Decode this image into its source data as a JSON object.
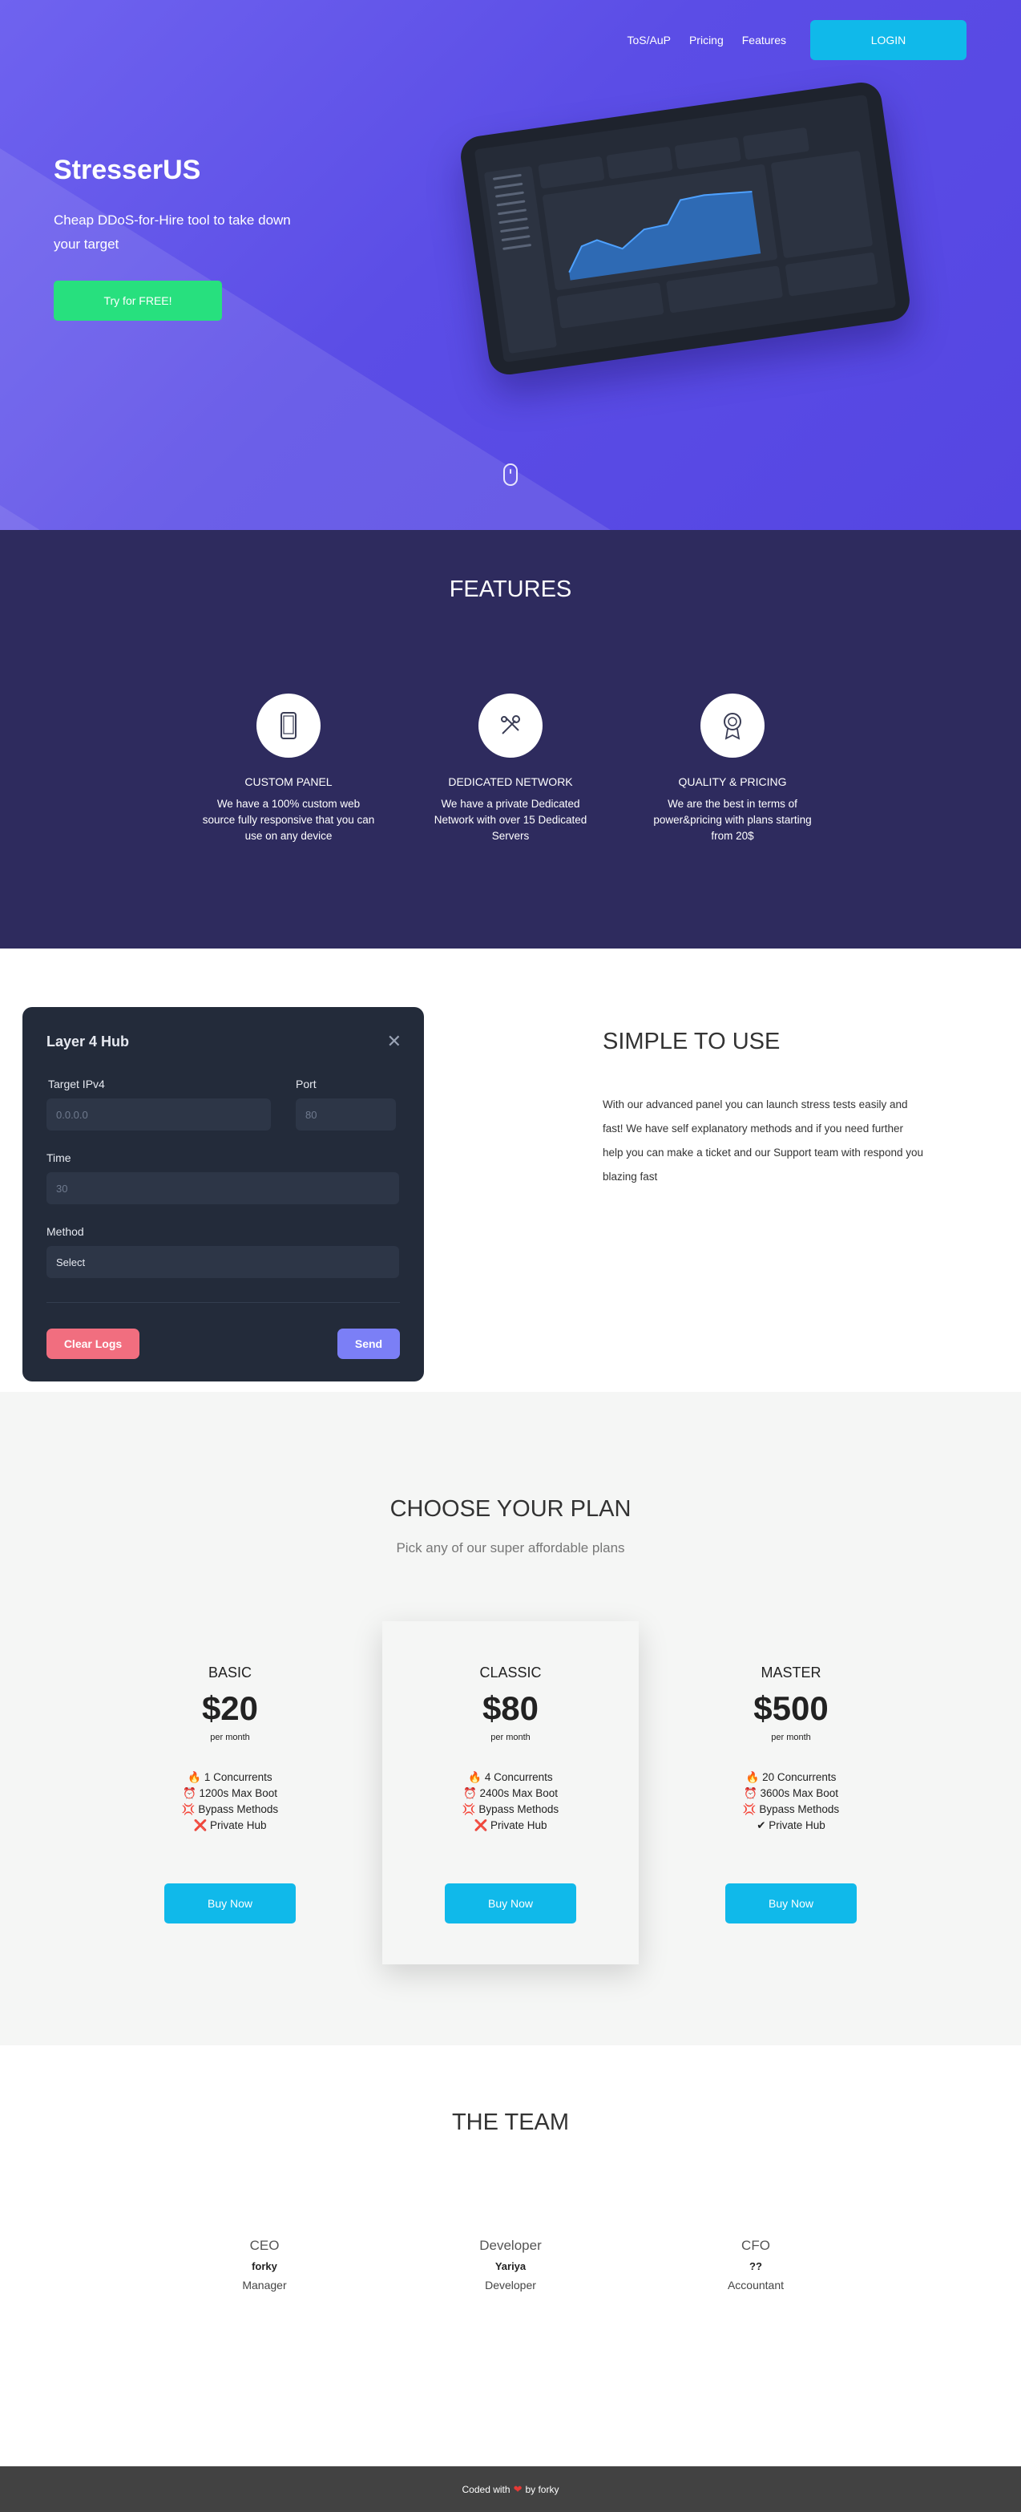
{
  "nav": {
    "tos": "ToS/AuP",
    "pricing": "Pricing",
    "features": "Features",
    "login": "LOGIN"
  },
  "hero": {
    "title": "StresserUS",
    "tagline": "Cheap DDoS-for-Hire tool to take down your target",
    "cta": "Try for FREE!"
  },
  "features": {
    "title": "FEATURES",
    "items": [
      {
        "icon": "mobile-icon",
        "title": "CUSTOM PANEL",
        "desc": "We have a 100% custom web source fully responsive that you can use on any device"
      },
      {
        "icon": "tools-icon",
        "title": "DEDICATED NETWORK",
        "desc": "We have a private Dedicated Network with over 15 Dedicated Servers"
      },
      {
        "icon": "award-icon",
        "title": "QUALITY & PRICING",
        "desc": "We are the best in terms of power&pricing with plans starting from 20$"
      }
    ]
  },
  "panel": {
    "title": "Layer 4 Hub",
    "target_label": "Target IPv4",
    "target_placeholder": "0.0.0.0",
    "port_label": "Port",
    "port_placeholder": "80",
    "time_label": "Time",
    "time_placeholder": "30",
    "method_label": "Method",
    "method_value": "Select",
    "clear": "Clear Logs",
    "send": "Send"
  },
  "simple": {
    "title": "SIMPLE TO USE",
    "text": "With our advanced panel you can launch stress tests easily and fast! We have self explanatory methods and if you need further help you can make a ticket and our Support team with respond you blazing fast"
  },
  "pricing": {
    "title": "CHOOSE YOUR PLAN",
    "subtitle": "Pick any of our super affordable plans",
    "plans": [
      {
        "name": "BASIC",
        "price": "$20",
        "per": "per month",
        "features": [
          "🔥 1 Concurrents",
          "⏰ 1200s Max Boot",
          "💢 Bypass Methods",
          "❌ Private Hub"
        ],
        "button": "Buy Now"
      },
      {
        "name": "CLASSIC",
        "price": "$80",
        "per": "per month",
        "features": [
          "🔥 4 Concurrents",
          "⏰ 2400s Max Boot",
          "💢 Bypass Methods",
          "❌ Private Hub"
        ],
        "button": "Buy Now"
      },
      {
        "name": "MASTER",
        "price": "$500",
        "per": "per month",
        "features": [
          "🔥 20 Concurrents",
          "⏰ 3600s Max Boot",
          "💢 Bypass Methods",
          "✔ Private Hub"
        ],
        "button": "Buy Now"
      }
    ]
  },
  "team": {
    "title": "THE TEAM",
    "members": [
      {
        "role": "CEO",
        "name": "forky",
        "title": "Manager"
      },
      {
        "role": "Developer",
        "name": "Yariya",
        "title": "Developer"
      },
      {
        "role": "CFO",
        "name": "??",
        "title": "Accountant"
      }
    ]
  },
  "footer": {
    "before": "Coded with",
    "after": "by forky"
  },
  "colors": {
    "hero": "#5b4de6",
    "features_bg": "#2e2b5e",
    "accent": "#10b9ea",
    "cta": "#27e07e",
    "panel_bg": "#232b3a"
  }
}
